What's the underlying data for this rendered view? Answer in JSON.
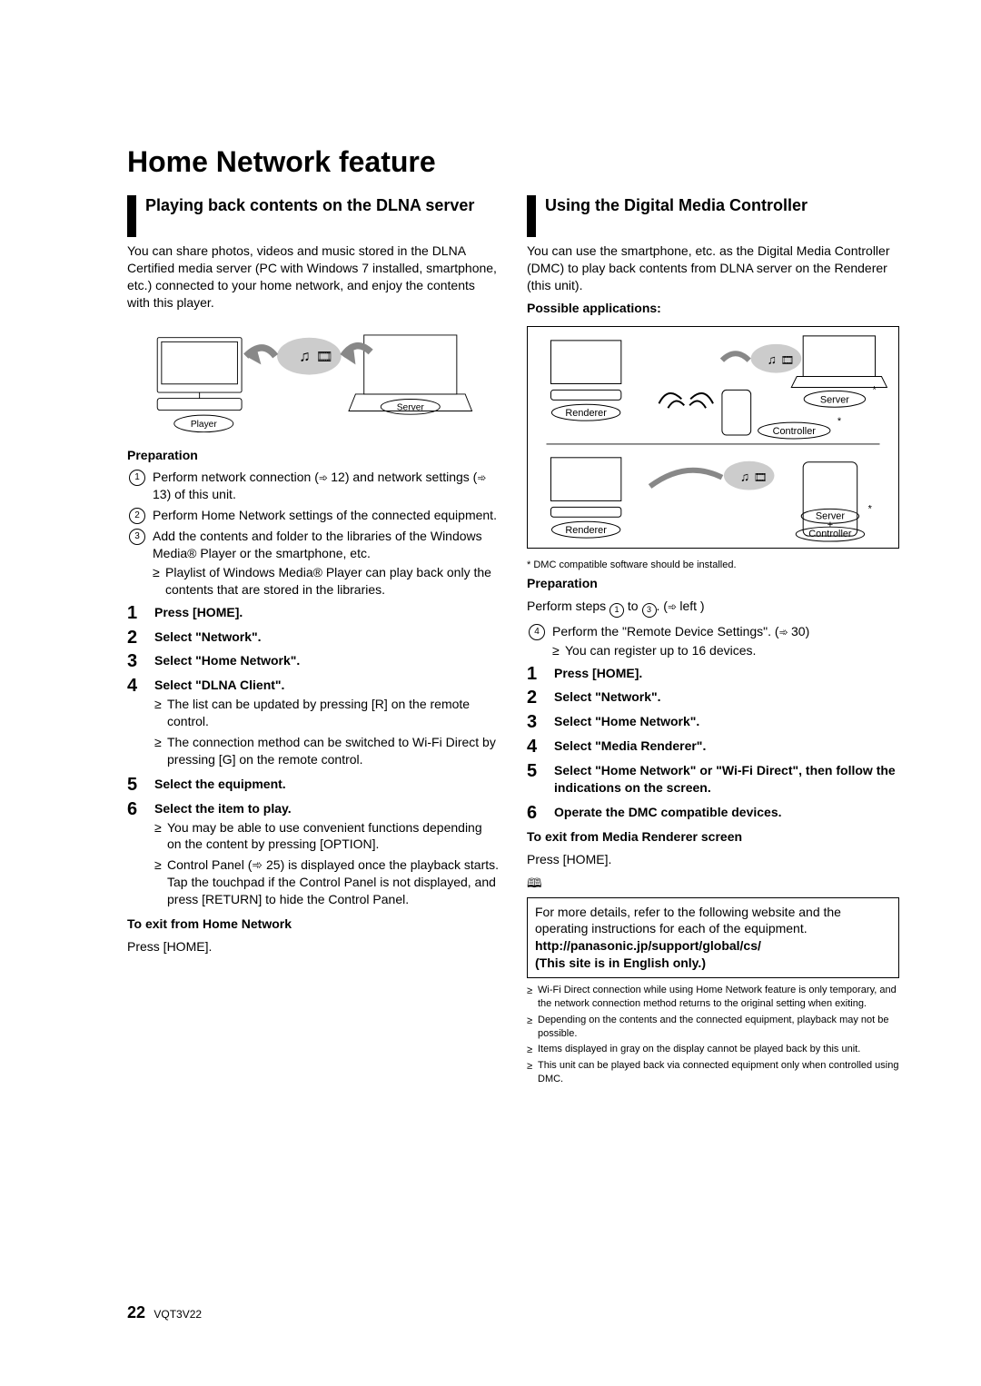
{
  "title": "Home Network feature",
  "left": {
    "heading": "Playing back contents on the DLNA server",
    "intro": "You can share photos, videos and music stored in the DLNA Certified media server (PC with Windows 7 installed, smartphone, etc.) connected to your home network, and enjoy the contents with this player.",
    "diagram": {
      "player": "Player",
      "server": "Server"
    },
    "prep_label": "Preparation",
    "prep": [
      {
        "text_a": "Perform network connection (",
        "xref": "12",
        "text_b": ") and network settings (",
        "xref2": "13",
        "text_c": ") of this unit."
      },
      {
        "text_a": "Perform Home Network settings of the connected equipment."
      },
      {
        "text_a": "Add the contents and folder to the libraries of the Windows Media® Player or the smartphone, etc."
      }
    ],
    "prep_sub": [
      "Playlist of Windows Media® Player can play back only the contents that are stored in the libraries."
    ],
    "steps": [
      {
        "text": "Press [HOME]."
      },
      {
        "text": "Select \"Network\"."
      },
      {
        "text": "Select \"Home Network\"."
      },
      {
        "text": "Select \"DLNA Client\".",
        "subs": [
          "The list can be updated by pressing [R] on the remote control.",
          "The connection method can be switched to Wi-Fi Direct by pressing [G] on the remote control."
        ]
      },
      {
        "text": "Select the equipment."
      },
      {
        "text": "Select the item to play.",
        "subs": [
          "You may be able to use convenient functions depending on the content by pressing [OPTION].",
          "Control Panel (➾ 25) is displayed once the playback starts. Tap the touchpad if the Control Panel is not displayed, and press [RETURN] to hide the Control Panel."
        ]
      }
    ],
    "exit_label": "To exit from Home Network",
    "exit_text": "Press [HOME]."
  },
  "right": {
    "heading": "Using the Digital Media Controller",
    "intro": "You can use the smartphone, etc. as the Digital Media Controller (DMC) to play back contents from DLNA server on the Renderer (this unit).",
    "apps_label": "Possible applications:",
    "diagram": {
      "renderer": "Renderer",
      "server": "Server",
      "controller": "Controller",
      "server2": "Server",
      "controller2": "Controller",
      "plus": "+"
    },
    "diag_note": "*  DMC compatible software should be installed.",
    "prep_label": "Preparation",
    "prep_intro_a": "Perform steps ",
    "prep_intro_b": " to ",
    "prep_intro_c": ". (",
    "prep_intro_d": "left )",
    "prep4_a": "Perform the \"Remote Device Settings\". (",
    "prep4_xref": "30",
    "prep4_b": ")",
    "prep4_sub": [
      "You can register up to 16 devices."
    ],
    "steps": [
      {
        "text": "Press [HOME]."
      },
      {
        "text": "Select \"Network\"."
      },
      {
        "text": "Select \"Home Network\"."
      },
      {
        "text": "Select \"Media Renderer\"."
      },
      {
        "text": "Select \"Home Network\" or \"Wi-Fi Direct\", then follow the indications on the screen."
      },
      {
        "text": "Operate the DMC compatible devices."
      }
    ],
    "exit_label": "To exit from Media Renderer screen",
    "exit_text": "Press [HOME].",
    "note_text": "For more details, refer to the following website and the operating instructions for each of the equipment.",
    "note_url": "http://panasonic.jp/support/global/cs/",
    "note_url_caption": "(This site is in English only.)",
    "small_notes": [
      "Wi-Fi Direct connection while using Home Network feature is only temporary, and the network connection method returns to the original setting when exiting.",
      "Depending on the contents and the connected equipment, playback may not be possible.",
      "Items displayed in gray on the display cannot be played back by this unit.",
      "This unit can be played back via connected equipment only when controlled using DMC."
    ]
  },
  "footer": {
    "page": "22",
    "code": "VQT3V22"
  }
}
